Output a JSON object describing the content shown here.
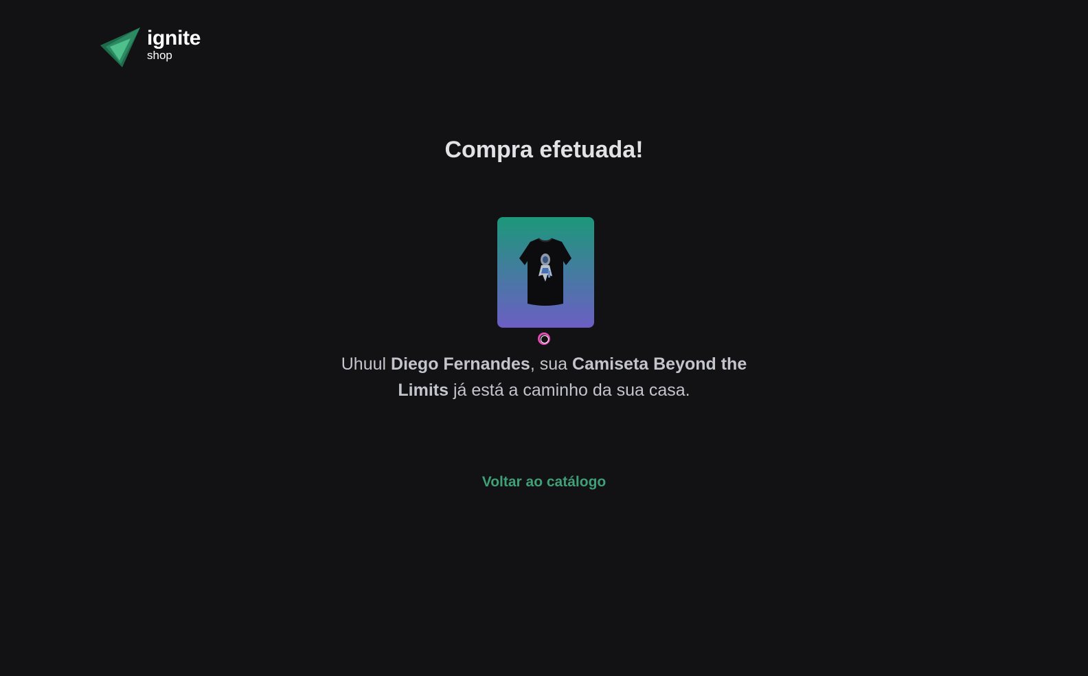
{
  "header": {
    "logo_title": "ignite",
    "logo_subtitle": "shop",
    "logo_icon": "triangle-logo-icon"
  },
  "main": {
    "title": "Compra efetuada!",
    "product_image_alt": "Camiseta Beyond the Limits",
    "message": {
      "prefix": "Uhuul ",
      "customer_name": "Diego Fernandes",
      "middle": ", sua ",
      "product_name": "Camiseta Beyond the Limits",
      "suffix": " já está a caminho da sua casa."
    },
    "back_link_label": "Voltar ao catálogo"
  },
  "colors": {
    "background": "#121214",
    "title": "#e1e1e6",
    "text": "#c4c4cc",
    "link": "#3f9f77",
    "gradient_top": "#1ea483",
    "gradient_bottom": "#7465d4",
    "cursor_ring": "#e54cb4"
  }
}
